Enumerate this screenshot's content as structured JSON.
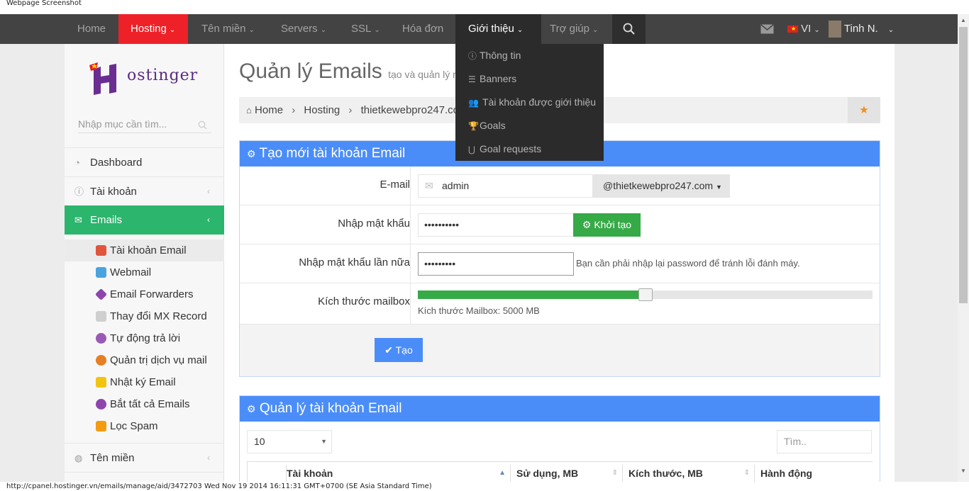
{
  "capture": {
    "title": "Webpage Screenshot",
    "status_url": "http://cpanel.hostinger.vn/emails/manage/aid/3472703 Wed Nov 19 2014 16:11:31 GMT+0700 (SE Asia Standard Time)"
  },
  "nav": {
    "home": "Home",
    "hosting": "Hosting",
    "domains": "Tên miền",
    "servers": "Servers",
    "ssl": "SSL",
    "invoices": "Hóa đơn",
    "referral": "Giới thiệu",
    "help": "Trợ giúp",
    "lang": "VI",
    "user": "Tinh N."
  },
  "dropdown": {
    "items": [
      "Thông tin",
      "Banners",
      "Tài khoản được giới thiệu",
      "Goals",
      "Goal requests"
    ]
  },
  "sidebar": {
    "logo": "ostinger",
    "search_placeholder": "Nhập mục cần tìm...",
    "items": {
      "dashboard": "Dashboard",
      "account": "Tài khoản",
      "emails": "Emails",
      "domains": "Tên miền"
    },
    "subitems": [
      "Tài khoản Email",
      "Webmail",
      "Email Forwarders",
      "Thay đổi MX Record",
      "Tự động trả lời",
      "Quản trị dịch vụ mail",
      "Nhật ký Email",
      "Bắt tất cả Emails",
      "Lọc Spam"
    ]
  },
  "main": {
    "title": "Quản lý Emails",
    "subtitle": "tạo và quản lý mai",
    "breadcrumb": {
      "home": "Home",
      "hosting": "Hosting",
      "domain": "thietkewebpro247.co"
    },
    "create_panel": {
      "title": "Tạo mới tài khoản Email",
      "email_label": "E-mail",
      "email_value": "admin",
      "domain_value": "@thietkewebpro247.com",
      "password_label": "Nhập mật khẩu",
      "password_value": "••••••••••",
      "generate_label": "Khởi tạo",
      "password2_label": "Nhập mật khẩu lần nữa",
      "password2_value": "•••••••••",
      "password2_hint": "Bạn cần phải nhập lại password để tránh lỗi đánh máy.",
      "mailbox_label": "Kích thước mailbox",
      "mailbox_hint": "Kích thước Mailbox: 5000 MB",
      "mailbox_fraction": 0.5,
      "create_label": "Tạo"
    },
    "manage_panel": {
      "title": "Quản lý tài khoản Email",
      "page_size": "10",
      "search_placeholder": "Tìm..",
      "columns": [
        "Tài khoản",
        "Sử dụng, MB",
        "Kích thước, MB",
        "Hành động"
      ]
    }
  }
}
